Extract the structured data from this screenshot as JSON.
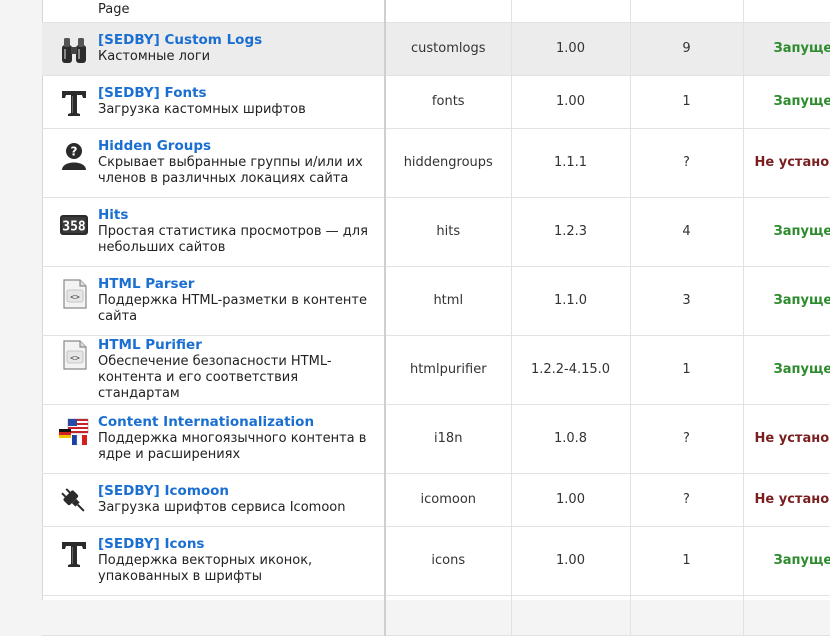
{
  "partial_row": {
    "desc": "Page"
  },
  "rows": [
    {
      "title": "[SEDBY] Custom Logs",
      "desc": "Кастомные логи",
      "code": "customlogs",
      "version": "1.00",
      "count": "9",
      "status": "Запущен",
      "icon": "binoculars-icon"
    },
    {
      "title": "[SEDBY] Fonts",
      "desc": "Загрузка кастомных шрифтов",
      "code": "fonts",
      "version": "1.00",
      "count": "1",
      "status": "Запущен",
      "icon": "font-t-icon"
    },
    {
      "title": "Hidden Groups",
      "desc": "Скрывает выбранные группы и/или их членов в различных локациях сайта",
      "code": "hiddengroups",
      "version": "1.1.1",
      "count": "?",
      "status": "Не установлен",
      "icon": "hidden-user-icon"
    },
    {
      "title": "Hits",
      "desc": "Простая статистика просмотров — для небольших сайтов",
      "code": "hits",
      "version": "1.2.3",
      "count": "4",
      "status": "Запущен",
      "icon": "hits-counter-icon"
    },
    {
      "title": "HTML Parser",
      "desc": "Поддержка HTML-разметки в контенте сайта",
      "code": "html",
      "version": "1.1.0",
      "count": "3",
      "status": "Запущен",
      "icon": "html-document-icon"
    },
    {
      "title": "HTML Purifier",
      "desc": "Обеспечение безопасности HTML-контента и его соответствия стандартам",
      "code": "htmlpurifier",
      "version": "1.2.2-4.15.0",
      "count": "1",
      "status": "Запущен",
      "icon": "html-document-icon"
    },
    {
      "title": "Content Internationalization",
      "desc": "Поддержка многоязычного контента в ядре и расширениях",
      "code": "i18n",
      "version": "1.0.8",
      "count": "?",
      "status": "Не установлен",
      "icon": "flags-icon"
    },
    {
      "title": "[SEDBY] Icomoon",
      "desc": "Загрузка шрифтов сервиса Icomoon",
      "code": "icomoon",
      "version": "1.00",
      "count": "?",
      "status": "Не установлен",
      "icon": "plug-icon"
    },
    {
      "title": "[SEDBY] Icons",
      "desc": "Поддержка векторных иконок, упакованных в шрифты",
      "code": "icons",
      "version": "1.00",
      "count": "1",
      "status": "Запущен",
      "icon": "font-t-icon"
    }
  ]
}
